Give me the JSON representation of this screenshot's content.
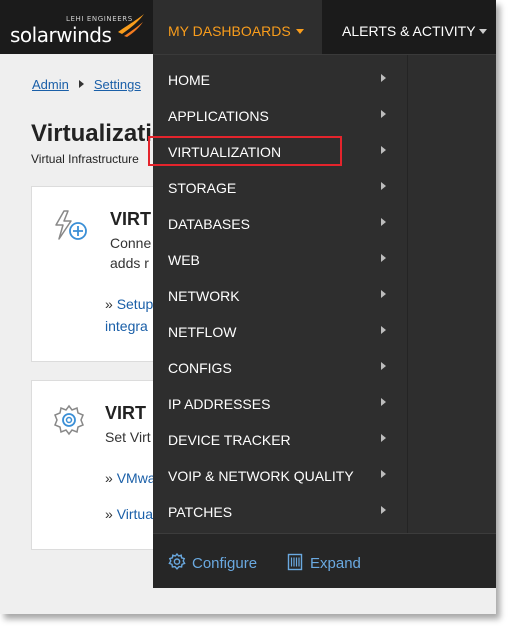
{
  "topnav": {
    "logo_tag": "LEHI ENGINEERS",
    "logo_word": "solarwinds",
    "my_dashboards": "MY DASHBOARDS",
    "alerts": "ALERTS & ACTIVITY"
  },
  "page": {
    "breadcrumb": [
      "Admin",
      "Settings"
    ],
    "title": "Virtualization",
    "subtitle": "Virtual Infrastructure",
    "cards": [
      {
        "title": "VIRT",
        "desc_lines": [
          "Conne",
          "adds r"
        ],
        "links": [
          "Setup",
          "integra"
        ]
      },
      {
        "title": "VIRT",
        "desc_lines": [
          "Set Virt"
        ],
        "links": [
          "VMwa",
          "Virtua"
        ]
      }
    ]
  },
  "dropdown": {
    "items": [
      "HOME",
      "APPLICATIONS",
      "VIRTUALIZATION",
      "STORAGE",
      "DATABASES",
      "WEB",
      "NETWORK",
      "NETFLOW",
      "CONFIGS",
      "IP ADDRESSES",
      "DEVICE TRACKER",
      "VOIP & NETWORK QUALITY",
      "PATCHES"
    ],
    "highlighted_item": "VIRTUALIZATION",
    "footer": {
      "configure": "Configure",
      "expand": "Expand"
    }
  },
  "colors": {
    "accent": "#f99d1c",
    "menu_bg": "#2e2e2e",
    "nav_bg": "#1b1b1b",
    "highlight_border": "#e4242c",
    "link": "#1a5fa8",
    "footer_link": "#6aa9e0"
  },
  "icons": {
    "lightning_plus": "lightning-plus-icon",
    "gear": "gear-icon",
    "configure": "gear-icon",
    "expand": "expand-icon",
    "submenu_arrow": "chevron-right-icon"
  }
}
